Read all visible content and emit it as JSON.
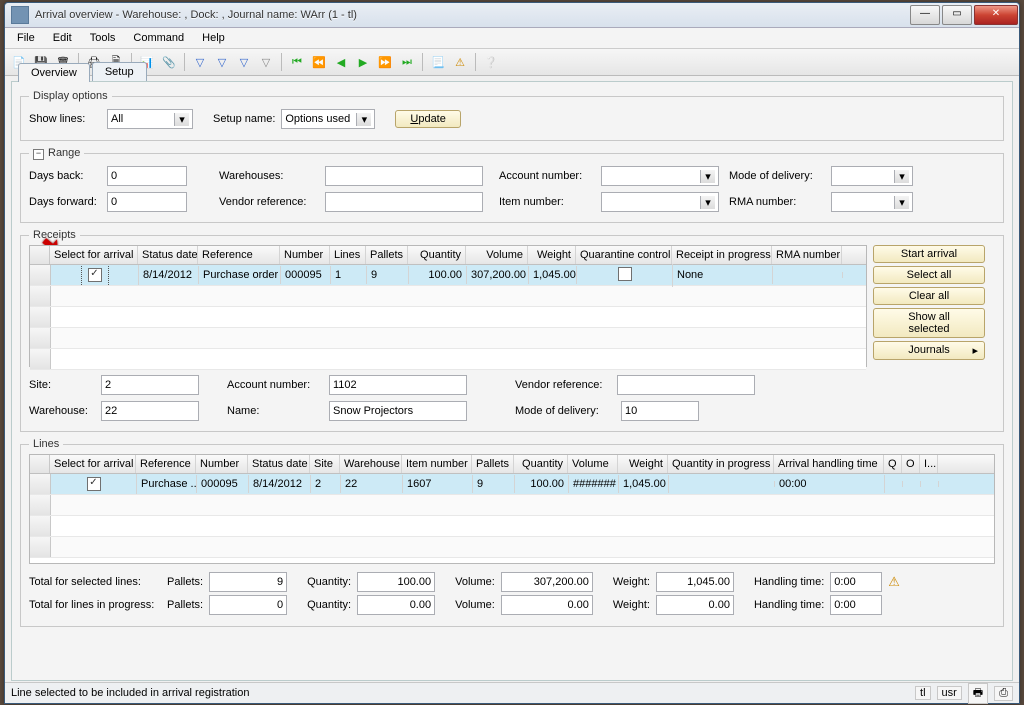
{
  "window": {
    "title": "Arrival overview - Warehouse: , Dock: , Journal name: WArr (1 - tl)"
  },
  "menu": [
    "File",
    "Edit",
    "Tools",
    "Command",
    "Help"
  ],
  "tabs": {
    "active": "Overview",
    "other": "Setup"
  },
  "display_options": {
    "legend": "Display options",
    "show_lines_label": "Show lines:",
    "show_lines_value": "All",
    "setup_name_label": "Setup name:",
    "setup_name_value": "Options used",
    "update_btn": "Update"
  },
  "range": {
    "legend": "Range",
    "days_back_label": "Days back:",
    "days_back": "0",
    "days_forward_label": "Days forward:",
    "days_forward": "0",
    "warehouses_label": "Warehouses:",
    "warehouses": "",
    "vendor_ref_label": "Vendor reference:",
    "vendor_ref": "",
    "account_label": "Account number:",
    "account": "",
    "item_label": "Item number:",
    "item": "",
    "mode_label": "Mode of delivery:",
    "mode": "",
    "rma_label": "RMA number:",
    "rma": ""
  },
  "receipts": {
    "legend": "Receipts",
    "columns": [
      "Select for arrival",
      "Status date",
      "Reference",
      "Number",
      "Lines",
      "Pallets",
      "Quantity",
      "Volume",
      "Weight",
      "Quarantine control",
      "Receipt in progress",
      "RMA number"
    ],
    "row": {
      "select": true,
      "status_date": "8/14/2012",
      "reference": "Purchase order",
      "number": "000095",
      "lines": "1",
      "pallets": "9",
      "quantity": "100.00",
      "volume": "307,200.00",
      "weight": "1,045.00",
      "quarantine": false,
      "receipt_in_progress": "None",
      "rma": ""
    },
    "actions": [
      "Start arrival",
      "Select all",
      "Clear all",
      "Show all selected",
      "Journals"
    ]
  },
  "detail": {
    "site_label": "Site:",
    "site": "2",
    "warehouse_label": "Warehouse:",
    "warehouse": "22",
    "account_label": "Account number:",
    "account": "1102",
    "name_label": "Name:",
    "name": "Snow Projectors",
    "vendor_ref_label": "Vendor reference:",
    "vendor_ref": "",
    "mode_label": "Mode of delivery:",
    "mode": "10"
  },
  "lines": {
    "legend": "Lines",
    "columns": [
      "Select for arrival",
      "Reference",
      "Number",
      "Status date",
      "Site",
      "Warehouse",
      "Item number",
      "Pallets",
      "Quantity",
      "Volume",
      "Weight",
      "Quantity in progress",
      "Arrival handling time",
      "Q",
      "O",
      "I..."
    ],
    "row": {
      "select": true,
      "reference": "Purchase ...",
      "number": "000095",
      "status_date": "8/14/2012",
      "site": "2",
      "warehouse": "22",
      "item": "1607",
      "pallets": "9",
      "quantity": "100.00",
      "volume": "#######",
      "weight": "1,045.00",
      "qip": "",
      "handling": "00:00"
    }
  },
  "totals": {
    "sel_label": "Total for selected lines:",
    "prog_label": "Total for lines in progress:",
    "pallets_label": "Pallets:",
    "quantity_label": "Quantity:",
    "volume_label": "Volume:",
    "weight_label": "Weight:",
    "handling_label": "Handling time:",
    "sel": {
      "pallets": "9",
      "quantity": "100.00",
      "volume": "307,200.00",
      "weight": "1,045.00",
      "handling": "0:00"
    },
    "prog": {
      "pallets": "0",
      "quantity": "0.00",
      "volume": "0.00",
      "weight": "0.00",
      "handling": "0:00"
    }
  },
  "status": {
    "msg": "Line selected to be included in arrival registration",
    "right": [
      "tl",
      "usr"
    ]
  }
}
